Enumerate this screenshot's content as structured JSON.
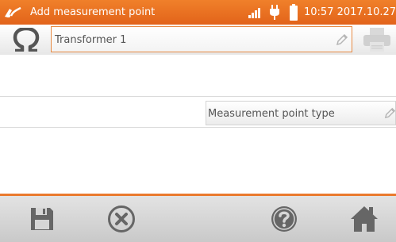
{
  "titlebar": {
    "title": "Add measurement point",
    "clock": "10:57 2017.10.27"
  },
  "object_field": {
    "value": "Transformer 1"
  },
  "type_field": {
    "placeholder": "Measurement point type"
  },
  "icons": {
    "app": "meter-probe-icon",
    "signal": "signal-strength-icon",
    "power": "plug-icon",
    "battery": "battery-icon",
    "omega": "omega-icon",
    "edit": "pencil-icon",
    "print": "printer-icon",
    "save": "save-icon",
    "cancel": "cancel-icon",
    "help": "help-icon",
    "home": "home-icon"
  },
  "colors": {
    "accent": "#e8702a",
    "bottom_icon": "#666666"
  }
}
